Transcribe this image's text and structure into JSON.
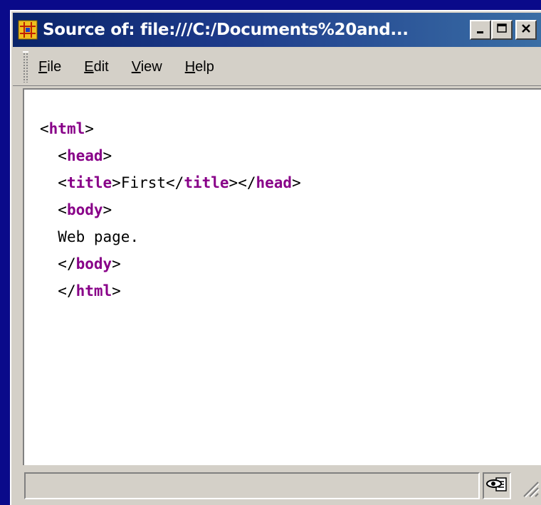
{
  "window": {
    "title": "Source of: file:///C:/Documents%20and...",
    "minimize_icon": "minimize-icon",
    "maximize_icon": "maximize-icon",
    "close_icon": "close-icon"
  },
  "menu": {
    "items": [
      {
        "label": "File",
        "mnemonic": "F",
        "rest": "ile"
      },
      {
        "label": "Edit",
        "mnemonic": "E",
        "rest": "dit"
      },
      {
        "label": "View",
        "mnemonic": "V",
        "rest": "iew"
      },
      {
        "label": "Help",
        "mnemonic": "H",
        "rest": "elp"
      }
    ]
  },
  "source": {
    "lines": [
      {
        "indent": "",
        "parts": [
          [
            "<",
            "tag"
          ],
          [
            "html",
            "tname"
          ],
          [
            ">",
            "tag"
          ]
        ]
      },
      {
        "indent": "  ",
        "parts": [
          [
            "<",
            "tag"
          ],
          [
            "head",
            "tname"
          ],
          [
            ">",
            "tag"
          ]
        ]
      },
      {
        "indent": "  ",
        "parts": [
          [
            "<",
            "tag"
          ],
          [
            "title",
            "tname"
          ],
          [
            ">First</",
            "tag"
          ],
          [
            "title",
            "tname"
          ],
          [
            "></",
            "tag"
          ],
          [
            "head",
            "tname"
          ],
          [
            ">",
            "tag"
          ]
        ]
      },
      {
        "indent": "  ",
        "parts": [
          [
            "<",
            "tag"
          ],
          [
            "body",
            "tname"
          ],
          [
            ">",
            "tag"
          ]
        ]
      },
      {
        "indent": "  ",
        "parts": [
          [
            "Web page.",
            "tag"
          ]
        ]
      },
      {
        "indent": "  ",
        "parts": [
          [
            "</",
            "tag"
          ],
          [
            "body",
            "tname"
          ],
          [
            ">",
            "tag"
          ]
        ]
      },
      {
        "indent": "  ",
        "parts": [
          [
            "</",
            "tag"
          ],
          [
            "html",
            "tname"
          ],
          [
            ">",
            "tag"
          ]
        ]
      }
    ]
  },
  "statusbar": {
    "text": "",
    "icon": "privacy-eye-icon"
  },
  "colors": {
    "desktop": "#0a0a8a",
    "titlebar_start": "#0a246a",
    "titlebar_end": "#3a6ea5",
    "tag_name": "#880088",
    "chrome": "#d4d0c8"
  }
}
